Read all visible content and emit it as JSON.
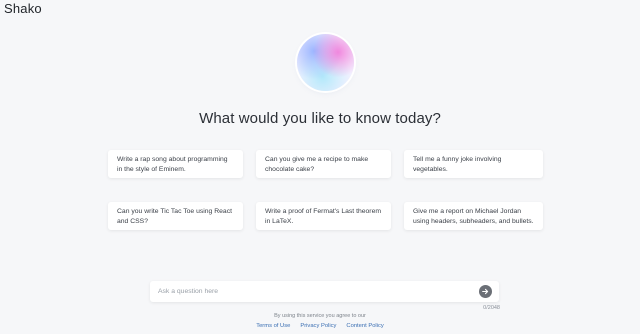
{
  "app": {
    "name": "Shako"
  },
  "hero": {
    "headline": "What would you like to know today?"
  },
  "suggestions": [
    "Write a rap song about programming in the style of Eminem.",
    "Can you give me a recipe to make chocolate cake?",
    "Tell me a funny joke involving vegetables.",
    "Can you write Tic Tac Toe using React and CSS?",
    "Write a proof of Fermat's Last theorem in LaTeX.",
    "Give me a report on Michael Jordan using headers, subheaders, and bullets."
  ],
  "composer": {
    "placeholder": "Ask a question here",
    "value": "",
    "counter": "0/2048"
  },
  "footer": {
    "disclaimer": "By using this service you agree to our",
    "links": [
      "Terms of Use",
      "Privacy Policy",
      "Content Policy"
    ]
  },
  "colors": {
    "background": "#f6f7f9",
    "send_button": "#6b6f76",
    "link": "#3b6fb3"
  },
  "icons": {
    "send": "arrow-right-icon",
    "orb": "gradient-orb"
  }
}
